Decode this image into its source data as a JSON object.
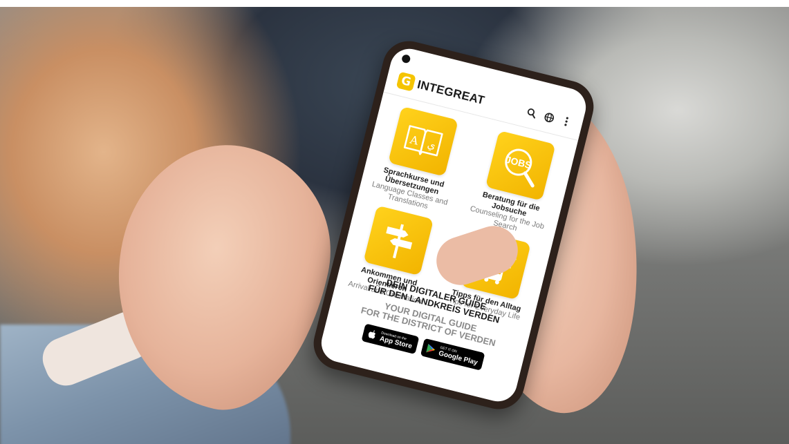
{
  "app": {
    "logo_mark": "G",
    "logo_text": "INTEGREAT",
    "icons": [
      "search-icon",
      "language-globe-icon",
      "more-vertical-icon"
    ]
  },
  "tiles": [
    {
      "id": "language",
      "icon": "book-translation-icon",
      "de": "Sprachkurse und Übersetzungen",
      "en": "Language Classes and Translations"
    },
    {
      "id": "jobs",
      "icon": "jobs-magnifier-icon",
      "icon_text": "JOBS",
      "de": "Beratung für die Jobsuche",
      "en": "Counseling for the Job Search"
    },
    {
      "id": "arrival",
      "icon": "signpost-icon",
      "de": "Ankommen und Orientieren",
      "en": "Arrival and Orientation"
    },
    {
      "id": "everyday",
      "icon": "euro-shirt-bus-icon",
      "de": "Tipps für den Alltag",
      "en": "Tips for Everyday Life"
    }
  ],
  "promo": {
    "de_line1": "DEIN DIGITALER GUIDE",
    "de_line2": "FÜR DEN LANDKREIS VERDEN",
    "en_line1": "YOUR DIGITAL GUIDE",
    "en_line2": "FOR THE DISTRICT OF VERDEN"
  },
  "stores": {
    "appstore_small": "Download on the",
    "appstore_name": "App Store",
    "googleplay_small": "GET IT ON",
    "googleplay_name": "Google Play"
  },
  "colors": {
    "brand_yellow": "#f5c400",
    "text_dark": "#1f1f1f",
    "text_grey": "#7c7c7c"
  }
}
